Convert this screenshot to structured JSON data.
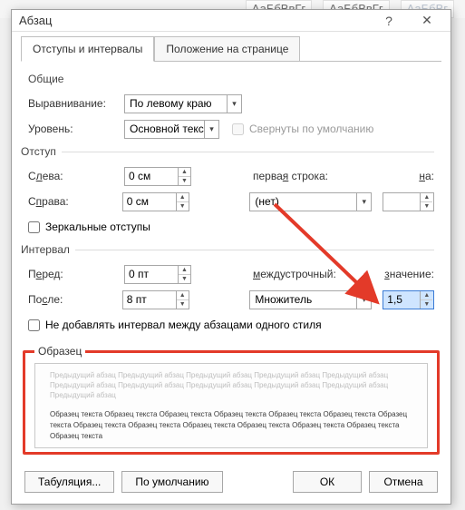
{
  "ribbon": {
    "style1": "АаБбВвГг",
    "style2": "АаБбВвГг",
    "style3": "АаБбВг"
  },
  "dialog": {
    "title": "Абзац",
    "tabs": {
      "indents": "Отступы и интервалы",
      "position": "Положение на странице"
    },
    "general": {
      "heading": "Общие",
      "align_label": "Выравнивание:",
      "align_value": "По левому краю",
      "level_label": "Уровень:",
      "level_value": "Основной текст",
      "collapse_label": "Свернуты по умолчанию"
    },
    "indent": {
      "heading": "Отступ",
      "left_label_pre": "С",
      "left_label_u": "л",
      "left_label_post": "ева:",
      "left_value": "0 см",
      "right_label_pre": "С",
      "right_label_u": "п",
      "right_label_post": "рава:",
      "right_value": "0 см",
      "firstline_label": "перва",
      "firstline_label_u": "я",
      "firstline_label_post": " строка:",
      "firstline_value": "(нет)",
      "on_label_u": "н",
      "on_label_post": "а:",
      "mirror_label": "Зеркальные отступы"
    },
    "interval": {
      "heading": "Интервал",
      "before_label_pre": "П",
      "before_label_u": "е",
      "before_label_post": "ред:",
      "before_value": "0 пт",
      "after_label_pre": "По",
      "after_label_u": "с",
      "after_label_post": "ле:",
      "after_value": "8 пт",
      "linespacing_label_u": "м",
      "linespacing_label_post": "еждустрочный:",
      "linespacing_value": "Множитель",
      "value_label_u": "з",
      "value_label_post": "начение:",
      "value_value": "1,5",
      "nospace_label": "Не добавлять интервал между абзацами одного стиля"
    },
    "preview": {
      "legend": "Образец",
      "prev": "Предыдущий абзац Предыдущий абзац Предыдущий абзац Предыдущий абзац Предыдущий абзац Предыдущий абзац Предыдущий абзац Предыдущий абзац Предыдущий абзац Предыдущий абзац Предыдущий абзац",
      "sample": "Образец текста Образец текста Образец текста Образец текста Образец текста Образец текста Образец текста Образец текста Образец текста Образец текста Образец текста Образец текста Образец текста Образец текста"
    },
    "buttons": {
      "tabs": "Табуляция...",
      "default": "По умолчанию",
      "ok": "ОК",
      "cancel": "Отмена"
    }
  }
}
